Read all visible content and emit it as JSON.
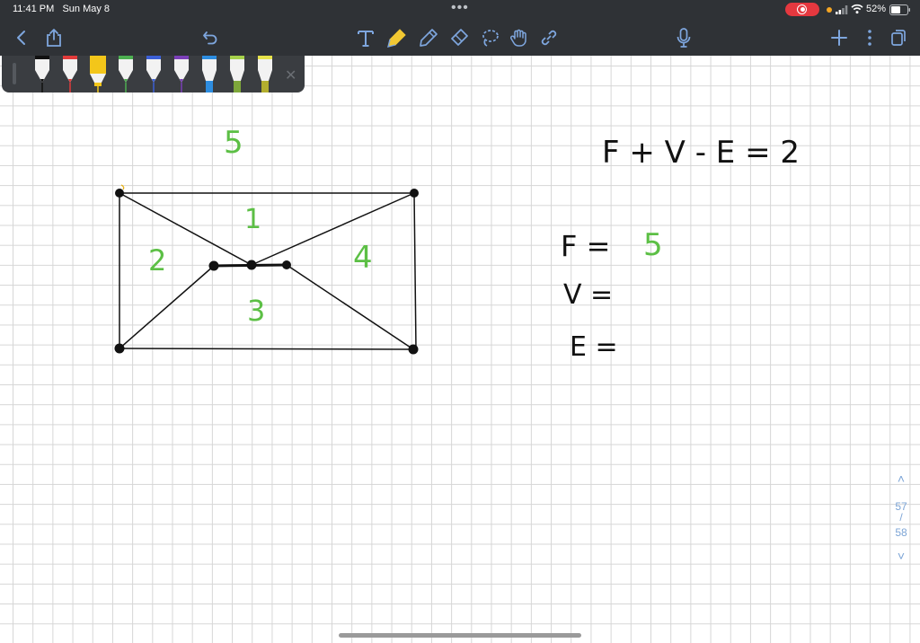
{
  "status": {
    "time": "11:41 PM",
    "date": "Sun May 8",
    "battery": "52%",
    "dots": "•••"
  },
  "toolbar": {
    "icons": [
      "back-chevron",
      "share",
      "undo",
      "text-tool",
      "highlighter",
      "pen",
      "eraser",
      "lasso",
      "hand-stamp",
      "link",
      "microphone",
      "add",
      "more",
      "pages"
    ]
  },
  "pens": {
    "colors": [
      "#111111",
      "#e23b3b",
      "#f3c61a",
      "#4caf50",
      "#3b5fd6",
      "#7b3fb8",
      "#2d8de0",
      "#a6d14b",
      "#e6e24a"
    ]
  },
  "notes": {
    "faces": {
      "outer": "5",
      "f1": "1",
      "f2": "2",
      "f3": "3",
      "f4": "4"
    },
    "formula": "F + V - E = 2",
    "f_label": "F =",
    "f_value": "5",
    "v_label": "V =",
    "e_label": "E ="
  },
  "pager": {
    "up": "˄",
    "current": "57",
    "slash": "/",
    "total": "58",
    "down": "˅"
  },
  "colors": {
    "chrome": "#2f3236",
    "ink_green": "#5cbf45",
    "ink_black": "#111111",
    "pager": "#7da5d6"
  }
}
